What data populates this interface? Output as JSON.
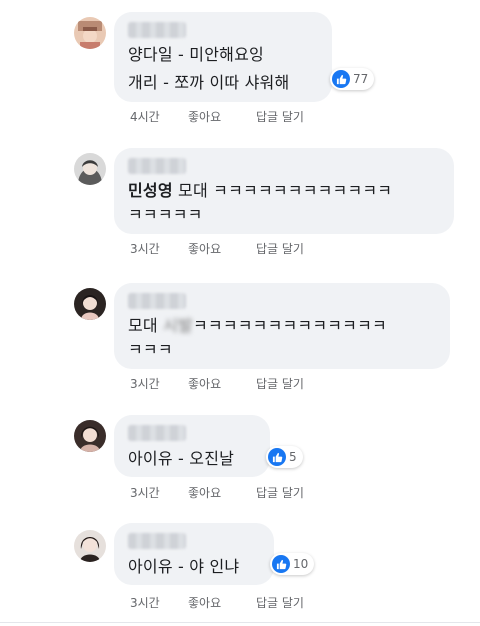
{
  "comments": [
    {
      "lines": [
        "양다일 - 미안해요잉",
        "개리 - 쪼까 이따 샤워해"
      ],
      "reactions": "77",
      "time": "4시간",
      "like": "좋아요",
      "reply": "답글 달기"
    },
    {
      "mention": "민성영",
      "line1_rest": " 모대 ㅋㅋㅋㅋㅋㅋㅋㅋㅋㅋㅋㅋ",
      "line2": "ㅋㅋㅋㅋㅋ",
      "time": "3시간",
      "like": "좋아요",
      "reply": "답글 달기"
    },
    {
      "line1_prefix": "모대 ",
      "censored": "시발",
      "line1_rest": "ㅋㅋㅋㅋㅋㅋㅋㅋㅋㅋㅋㅋㅋ",
      "line2": "ㅋㅋㅋ",
      "time": "3시간",
      "like": "좋아요",
      "reply": "답글 달기"
    },
    {
      "line": "아이유 - 오진날",
      "reactions": "5",
      "time": "3시간",
      "like": "좋아요",
      "reply": "답글 달기"
    },
    {
      "line": "아이유 - 야 인냐",
      "reactions": "10",
      "time": "3시간",
      "like": "좋아요",
      "reply": "답글 달기"
    }
  ],
  "colors": {
    "bubble": "#f0f2f5",
    "like_blue": "#1877f2",
    "meta_text": "#65676b"
  },
  "icons": {
    "reaction": "thumbs-up-icon"
  }
}
